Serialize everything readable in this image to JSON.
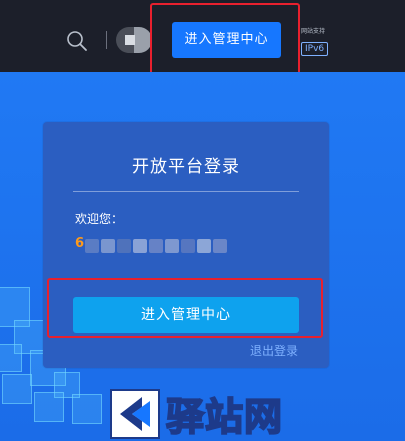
{
  "header": {
    "search_icon": "search-icon",
    "manage_button_label": "进入管理中心",
    "ipv6_caption": "网站支持",
    "ipv6_tag": "IPv6"
  },
  "login_card": {
    "title": "开放平台登录",
    "welcome_label": "欢迎您：",
    "username_prefix": "6",
    "enter_button_label": "进入管理中心",
    "logout_label": "退出登录"
  },
  "watermark": {
    "text": "驿站网"
  },
  "colors": {
    "accent": "#1677ff",
    "highlight": "#e8202e",
    "username": "#ff9a1a",
    "hero": "#1e6ff0"
  }
}
